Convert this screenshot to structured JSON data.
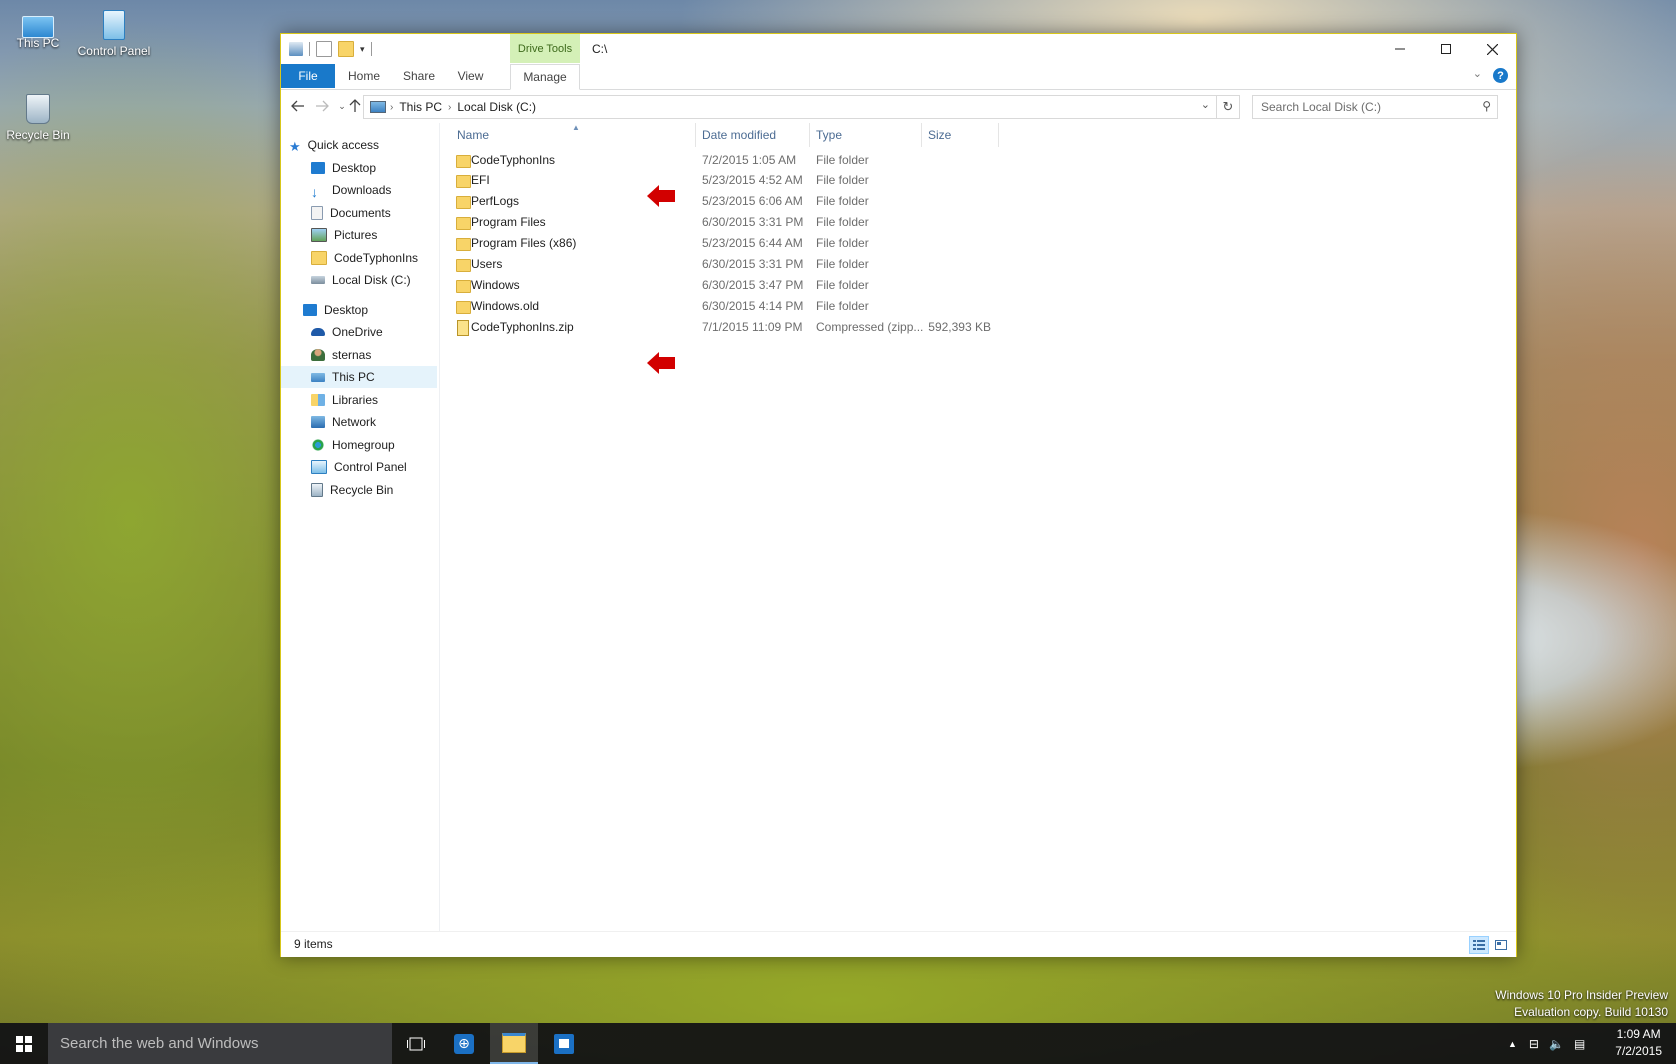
{
  "desktop": {
    "icons": [
      {
        "label": "This PC"
      },
      {
        "label": "Control Panel"
      },
      {
        "label": "Recycle Bin"
      }
    ],
    "watermark": [
      "Windows 10 Pro Insider Preview",
      "Evaluation copy. Build 10130"
    ]
  },
  "window": {
    "title": "C:\\",
    "contextual_tab": "Drive Tools",
    "tabs": [
      "File",
      "Home",
      "Share",
      "View",
      "Manage"
    ],
    "breadcrumb": [
      "This PC",
      "Local Disk (C:)"
    ],
    "search_placeholder": "Search Local Disk (C:)",
    "help_label": "?"
  },
  "navpane": {
    "items": [
      {
        "label": "Quick access",
        "icon": "star-icon",
        "pinned": false
      },
      {
        "label": "Desktop",
        "icon": "desktop-icon",
        "pinned": true
      },
      {
        "label": "Downloads",
        "icon": "downloads-icon",
        "pinned": true
      },
      {
        "label": "Documents",
        "icon": "documents-icon",
        "pinned": true
      },
      {
        "label": "Pictures",
        "icon": "pictures-icon",
        "pinned": true
      },
      {
        "label": "CodeTyphonIns",
        "icon": "folder-icon",
        "pinned": false
      },
      {
        "label": "Local Disk (C:)",
        "icon": "drive-icon",
        "pinned": false
      },
      {
        "label": "Desktop",
        "icon": "desktop-icon",
        "pinned": false
      },
      {
        "label": "OneDrive",
        "icon": "onedrive-icon",
        "pinned": false
      },
      {
        "label": "sternas",
        "icon": "user-icon",
        "pinned": false
      },
      {
        "label": "This PC",
        "icon": "this-pc-icon",
        "pinned": false,
        "selected": true
      },
      {
        "label": "Libraries",
        "icon": "libraries-icon",
        "pinned": false
      },
      {
        "label": "Network",
        "icon": "network-icon",
        "pinned": false
      },
      {
        "label": "Homegroup",
        "icon": "homegroup-icon",
        "pinned": false
      },
      {
        "label": "Control Panel",
        "icon": "control-panel-icon",
        "pinned": false
      },
      {
        "label": "Recycle Bin",
        "icon": "recycle-bin-icon",
        "pinned": false
      }
    ]
  },
  "filelist": {
    "columns": [
      "Name",
      "Date modified",
      "Type",
      "Size"
    ],
    "rows": [
      {
        "name": "CodeTyphonIns",
        "date": "7/2/2015 1:05 AM",
        "type": "File folder",
        "size": "",
        "kind": "folder",
        "highlight": true
      },
      {
        "name": "EFI",
        "date": "5/23/2015 4:52 AM",
        "type": "File folder",
        "size": "",
        "kind": "folder"
      },
      {
        "name": "PerfLogs",
        "date": "5/23/2015 6:06 AM",
        "type": "File folder",
        "size": "",
        "kind": "folder"
      },
      {
        "name": "Program Files",
        "date": "6/30/2015 3:31 PM",
        "type": "File folder",
        "size": "",
        "kind": "folder"
      },
      {
        "name": "Program Files (x86)",
        "date": "5/23/2015 6:44 AM",
        "type": "File folder",
        "size": "",
        "kind": "folder"
      },
      {
        "name": "Users",
        "date": "6/30/2015 3:31 PM",
        "type": "File folder",
        "size": "",
        "kind": "folder"
      },
      {
        "name": "Windows",
        "date": "6/30/2015 3:47 PM",
        "type": "File folder",
        "size": "",
        "kind": "folder"
      },
      {
        "name": "Windows.old",
        "date": "6/30/2015 4:14 PM",
        "type": "File folder",
        "size": "",
        "kind": "folder"
      },
      {
        "name": "CodeTyphonIns.zip",
        "date": "7/1/2015 11:09 PM",
        "type": "Compressed (zipp...",
        "size": "592,393 KB",
        "kind": "zip",
        "highlight": true
      }
    ]
  },
  "status": {
    "items_count": "9 items"
  },
  "taskbar": {
    "search_placeholder": "Search the web and Windows",
    "time": "1:09 AM",
    "date": "7/2/2015"
  },
  "colors": {
    "accent": "#1979ca",
    "drive_tools": "#d4f0b7",
    "arrow": "#d20000",
    "selection": "#e5f3fb"
  }
}
